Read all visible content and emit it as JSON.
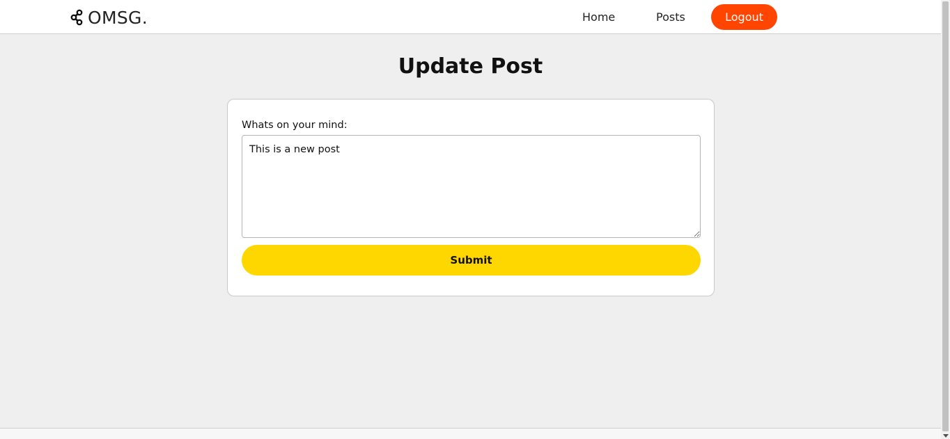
{
  "brand": {
    "name": "OMSG.",
    "icon": "share-nodes-icon"
  },
  "nav": {
    "home_label": "Home",
    "posts_label": "Posts",
    "logout_label": "Logout"
  },
  "page": {
    "title": "Update Post"
  },
  "form": {
    "label": "Whats on your mind:",
    "textarea_value": "This is a new post",
    "submit_label": "Submit"
  },
  "colors": {
    "logout": "#ff4500",
    "submit": "#ffd700",
    "background": "#efefef"
  }
}
